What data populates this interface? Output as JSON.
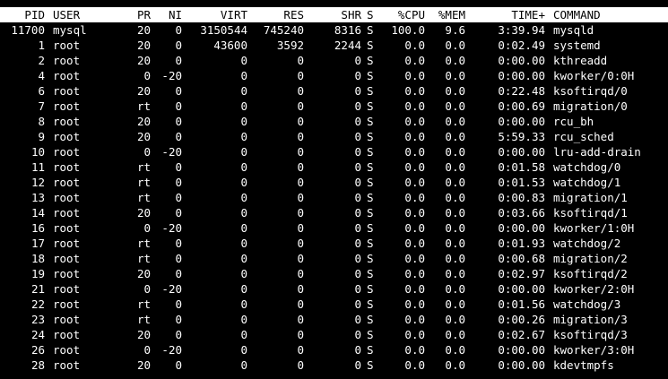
{
  "header": {
    "pid": "PID",
    "user": "USER",
    "pr": "PR",
    "ni": "NI",
    "virt": "VIRT",
    "res": "RES",
    "shr": "SHR",
    "s": "S",
    "cpu": "%CPU",
    "mem": "%MEM",
    "time": "TIME+",
    "command": "COMMAND"
  },
  "processes": [
    {
      "pid": "11700",
      "user": "mysql",
      "pr": "20",
      "ni": "0",
      "virt": "3150544",
      "res": "745240",
      "shr": "8316",
      "s": "S",
      "cpu": "100.0",
      "mem": "9.6",
      "time": "3:39.94",
      "command": "mysqld"
    },
    {
      "pid": "1",
      "user": "root",
      "pr": "20",
      "ni": "0",
      "virt": "43600",
      "res": "3592",
      "shr": "2244",
      "s": "S",
      "cpu": "0.0",
      "mem": "0.0",
      "time": "0:02.49",
      "command": "systemd"
    },
    {
      "pid": "2",
      "user": "root",
      "pr": "20",
      "ni": "0",
      "virt": "0",
      "res": "0",
      "shr": "0",
      "s": "S",
      "cpu": "0.0",
      "mem": "0.0",
      "time": "0:00.00",
      "command": "kthreadd"
    },
    {
      "pid": "4",
      "user": "root",
      "pr": "0",
      "ni": "-20",
      "virt": "0",
      "res": "0",
      "shr": "0",
      "s": "S",
      "cpu": "0.0",
      "mem": "0.0",
      "time": "0:00.00",
      "command": "kworker/0:0H"
    },
    {
      "pid": "6",
      "user": "root",
      "pr": "20",
      "ni": "0",
      "virt": "0",
      "res": "0",
      "shr": "0",
      "s": "S",
      "cpu": "0.0",
      "mem": "0.0",
      "time": "0:22.48",
      "command": "ksoftirqd/0"
    },
    {
      "pid": "7",
      "user": "root",
      "pr": "rt",
      "ni": "0",
      "virt": "0",
      "res": "0",
      "shr": "0",
      "s": "S",
      "cpu": "0.0",
      "mem": "0.0",
      "time": "0:00.69",
      "command": "migration/0"
    },
    {
      "pid": "8",
      "user": "root",
      "pr": "20",
      "ni": "0",
      "virt": "0",
      "res": "0",
      "shr": "0",
      "s": "S",
      "cpu": "0.0",
      "mem": "0.0",
      "time": "0:00.00",
      "command": "rcu_bh"
    },
    {
      "pid": "9",
      "user": "root",
      "pr": "20",
      "ni": "0",
      "virt": "0",
      "res": "0",
      "shr": "0",
      "s": "S",
      "cpu": "0.0",
      "mem": "0.0",
      "time": "5:59.33",
      "command": "rcu_sched"
    },
    {
      "pid": "10",
      "user": "root",
      "pr": "0",
      "ni": "-20",
      "virt": "0",
      "res": "0",
      "shr": "0",
      "s": "S",
      "cpu": "0.0",
      "mem": "0.0",
      "time": "0:00.00",
      "command": "lru-add-drain"
    },
    {
      "pid": "11",
      "user": "root",
      "pr": "rt",
      "ni": "0",
      "virt": "0",
      "res": "0",
      "shr": "0",
      "s": "S",
      "cpu": "0.0",
      "mem": "0.0",
      "time": "0:01.58",
      "command": "watchdog/0"
    },
    {
      "pid": "12",
      "user": "root",
      "pr": "rt",
      "ni": "0",
      "virt": "0",
      "res": "0",
      "shr": "0",
      "s": "S",
      "cpu": "0.0",
      "mem": "0.0",
      "time": "0:01.53",
      "command": "watchdog/1"
    },
    {
      "pid": "13",
      "user": "root",
      "pr": "rt",
      "ni": "0",
      "virt": "0",
      "res": "0",
      "shr": "0",
      "s": "S",
      "cpu": "0.0",
      "mem": "0.0",
      "time": "0:00.83",
      "command": "migration/1"
    },
    {
      "pid": "14",
      "user": "root",
      "pr": "20",
      "ni": "0",
      "virt": "0",
      "res": "0",
      "shr": "0",
      "s": "S",
      "cpu": "0.0",
      "mem": "0.0",
      "time": "0:03.66",
      "command": "ksoftirqd/1"
    },
    {
      "pid": "16",
      "user": "root",
      "pr": "0",
      "ni": "-20",
      "virt": "0",
      "res": "0",
      "shr": "0",
      "s": "S",
      "cpu": "0.0",
      "mem": "0.0",
      "time": "0:00.00",
      "command": "kworker/1:0H"
    },
    {
      "pid": "17",
      "user": "root",
      "pr": "rt",
      "ni": "0",
      "virt": "0",
      "res": "0",
      "shr": "0",
      "s": "S",
      "cpu": "0.0",
      "mem": "0.0",
      "time": "0:01.93",
      "command": "watchdog/2"
    },
    {
      "pid": "18",
      "user": "root",
      "pr": "rt",
      "ni": "0",
      "virt": "0",
      "res": "0",
      "shr": "0",
      "s": "S",
      "cpu": "0.0",
      "mem": "0.0",
      "time": "0:00.68",
      "command": "migration/2"
    },
    {
      "pid": "19",
      "user": "root",
      "pr": "20",
      "ni": "0",
      "virt": "0",
      "res": "0",
      "shr": "0",
      "s": "S",
      "cpu": "0.0",
      "mem": "0.0",
      "time": "0:02.97",
      "command": "ksoftirqd/2"
    },
    {
      "pid": "21",
      "user": "root",
      "pr": "0",
      "ni": "-20",
      "virt": "0",
      "res": "0",
      "shr": "0",
      "s": "S",
      "cpu": "0.0",
      "mem": "0.0",
      "time": "0:00.00",
      "command": "kworker/2:0H"
    },
    {
      "pid": "22",
      "user": "root",
      "pr": "rt",
      "ni": "0",
      "virt": "0",
      "res": "0",
      "shr": "0",
      "s": "S",
      "cpu": "0.0",
      "mem": "0.0",
      "time": "0:01.56",
      "command": "watchdog/3"
    },
    {
      "pid": "23",
      "user": "root",
      "pr": "rt",
      "ni": "0",
      "virt": "0",
      "res": "0",
      "shr": "0",
      "s": "S",
      "cpu": "0.0",
      "mem": "0.0",
      "time": "0:00.26",
      "command": "migration/3"
    },
    {
      "pid": "24",
      "user": "root",
      "pr": "20",
      "ni": "0",
      "virt": "0",
      "res": "0",
      "shr": "0",
      "s": "S",
      "cpu": "0.0",
      "mem": "0.0",
      "time": "0:02.67",
      "command": "ksoftirqd/3"
    },
    {
      "pid": "26",
      "user": "root",
      "pr": "0",
      "ni": "-20",
      "virt": "0",
      "res": "0",
      "shr": "0",
      "s": "S",
      "cpu": "0.0",
      "mem": "0.0",
      "time": "0:00.00",
      "command": "kworker/3:0H"
    },
    {
      "pid": "28",
      "user": "root",
      "pr": "20",
      "ni": "0",
      "virt": "0",
      "res": "0",
      "shr": "0",
      "s": "S",
      "cpu": "0.0",
      "mem": "0.0",
      "time": "0:00.00",
      "command": "kdevtmpfs"
    }
  ],
  "colors": {
    "background": "#000000",
    "foreground": "#ffffff",
    "header_background": "#ffffff",
    "header_foreground": "#000000"
  }
}
